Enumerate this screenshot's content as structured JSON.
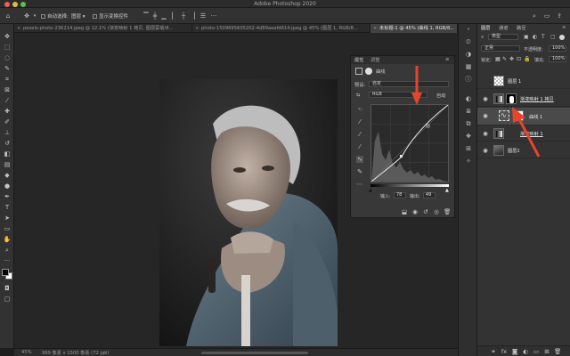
{
  "window": {
    "title": "Adobe Photoshop 2020"
  },
  "options_bar": {
    "auto_select_label": "自动选择:",
    "auto_select_target": "图层",
    "transform_controls_label": "显示变换控件"
  },
  "document_tabs": [
    {
      "label": "pexels-photo-236214.jpeg @ 12.1% (渐变映射 1 拷贝, 图层蒙版/8...",
      "active": false
    },
    {
      "label": "photo-1509695605202-4d89aeafd614.jpeg @ 45% (图层 1, RGB/8...",
      "active": false
    },
    {
      "label": "未标题-1 @ 45% (曲线 1, RGB/8...",
      "active": true
    }
  ],
  "properties_panel": {
    "tabs": [
      "属性",
      "调整"
    ],
    "panel_title": "曲线",
    "preset_label": "预设:",
    "preset_value": "自定",
    "channel_value": "RGB",
    "auto_label": "自动",
    "input_label": "输入:",
    "input_value": "78",
    "output_label": "输出:",
    "output_value": "49"
  },
  "layers_panel": {
    "tabs": [
      "图层",
      "通道",
      "路径"
    ],
    "kind_filter": "类型",
    "blend_mode": "正常",
    "opacity_label": "不透明度:",
    "opacity_value": "100%",
    "lock_label": "锁定:",
    "fill_label": "填充:",
    "fill_value": "100%",
    "layers": [
      {
        "name": "图层 1",
        "visible": false,
        "selected": false
      },
      {
        "name": "渐变映射 1 拷贝",
        "visible": true,
        "selected": false
      },
      {
        "name": "曲线 1",
        "visible": true,
        "selected": true
      },
      {
        "name": "渐变映射 1",
        "visible": true,
        "selected": false
      },
      {
        "name": "图层1",
        "visible": true,
        "selected": false
      }
    ]
  },
  "status_bar": {
    "zoom": "45%",
    "doc_info": "999 像素 x 1500 像素 (72 ppi)"
  },
  "colors": {
    "annotation_arrow": "#e8442c",
    "selection_highlight": "#4a4a4a"
  }
}
